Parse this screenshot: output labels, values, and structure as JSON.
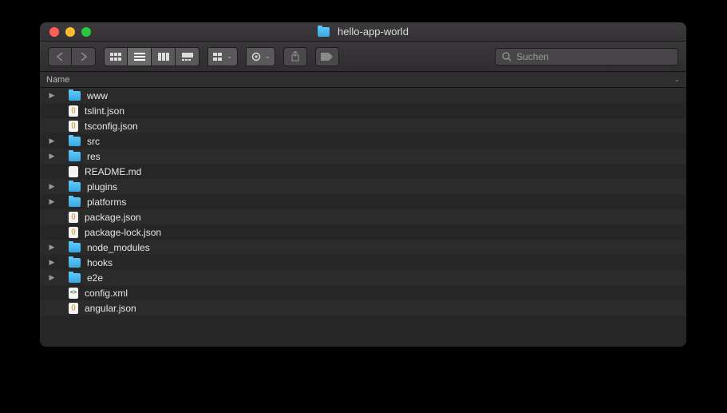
{
  "window": {
    "title": "hello-app-world"
  },
  "toolbar": {
    "search_placeholder": "Suchen"
  },
  "columns": {
    "name": "Name"
  },
  "items": [
    {
      "name": "www",
      "type": "folder",
      "expandable": true
    },
    {
      "name": "tslint.json",
      "type": "json",
      "expandable": false
    },
    {
      "name": "tsconfig.json",
      "type": "json",
      "expandable": false
    },
    {
      "name": "src",
      "type": "folder",
      "expandable": true
    },
    {
      "name": "res",
      "type": "folder",
      "expandable": true
    },
    {
      "name": "README.md",
      "type": "md",
      "expandable": false
    },
    {
      "name": "plugins",
      "type": "folder",
      "expandable": true
    },
    {
      "name": "platforms",
      "type": "folder",
      "expandable": true
    },
    {
      "name": "package.json",
      "type": "json",
      "expandable": false
    },
    {
      "name": "package-lock.json",
      "type": "json",
      "expandable": false
    },
    {
      "name": "node_modules",
      "type": "folder",
      "expandable": true
    },
    {
      "name": "hooks",
      "type": "folder",
      "expandable": true
    },
    {
      "name": "e2e",
      "type": "folder",
      "expandable": true
    },
    {
      "name": "config.xml",
      "type": "xml",
      "expandable": false
    },
    {
      "name": "angular.json",
      "type": "json",
      "expandable": false
    }
  ]
}
